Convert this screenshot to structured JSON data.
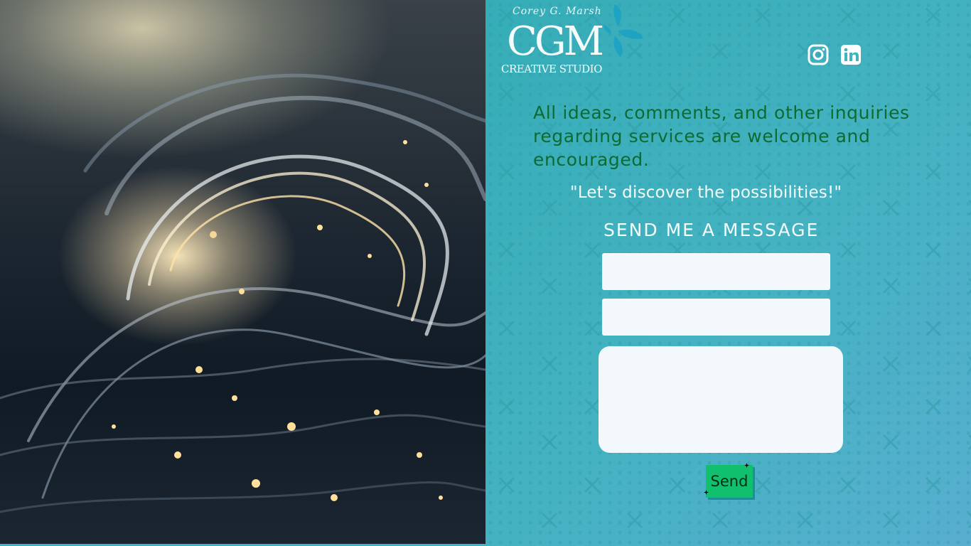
{
  "hero": {
    "image_name": "glowing-ocean-wave",
    "colors": {
      "deep": "#0f1a24",
      "glow": "#ffe8b8"
    }
  },
  "logo": {
    "signature": "Corey G. Marsh",
    "monogram": "CGM",
    "studio": "CREATIVE STUDIO",
    "splash_color": "#1fa3c2"
  },
  "social": [
    {
      "icon": "instagram-icon"
    },
    {
      "icon": "linkedin-icon"
    }
  ],
  "content": {
    "intro": "All ideas, comments, and other inquiries regarding services are welcome and encouraged.",
    "tagline": "\"Let's discover the possibilities!\"",
    "form_title": "SEND ME A MESSAGE"
  },
  "form": {
    "name_value": "",
    "email_value": "",
    "message_value": "",
    "send_label": "Send"
  },
  "colors": {
    "panel": "#3fb3bf",
    "intro_text": "#0d6b32",
    "button": "#11c06d",
    "field": "#f2f8fc"
  }
}
